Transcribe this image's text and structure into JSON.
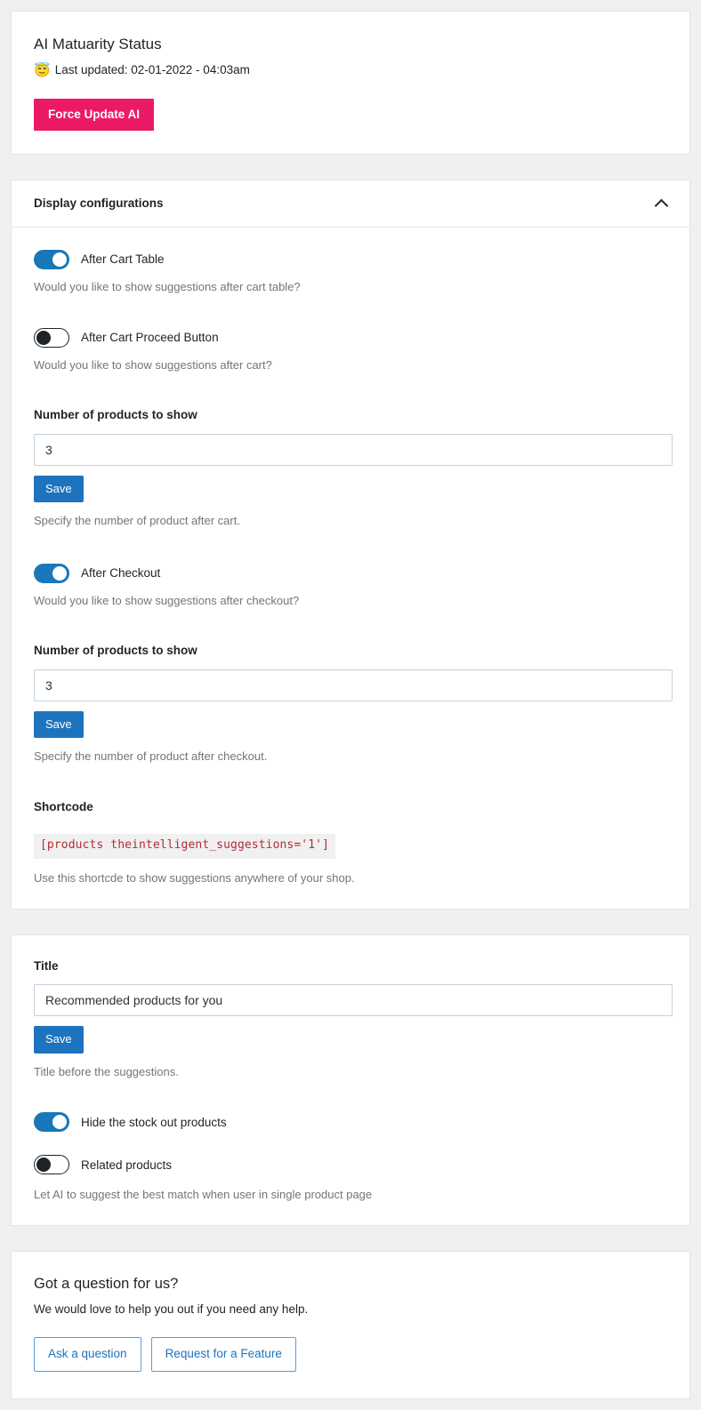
{
  "status_card": {
    "title": "AI Matuarity Status",
    "emoji": "😇",
    "last_updated": "Last updated: 02-01-2022 - 04:03am",
    "force_update_label": "Force Update AI"
  },
  "display_config": {
    "header_title": "Display configurations",
    "collapse_icon": "chevron-up-icon",
    "toggles": [
      {
        "label": "After Cart Table",
        "state": "on",
        "helper": "Would you like to show suggestions after cart table?"
      },
      {
        "label": "After Cart Proceed Button",
        "state": "off",
        "helper": "Would you like to show suggestions after cart?"
      }
    ],
    "after_cart_count": {
      "label": "Number of products to show",
      "value": "3",
      "save_label": "Save",
      "helper": "Specify the number of product after cart."
    },
    "after_checkout_toggle": {
      "label": "After Checkout",
      "state": "on",
      "helper": "Would you like to show suggestions after checkout?"
    },
    "after_checkout_count": {
      "label": "Number of products to show",
      "value": "3",
      "save_label": "Save",
      "helper": "Specify the number of product after checkout."
    },
    "shortcode": {
      "label": "Shortcode",
      "code": "[products theintelligent_suggestions='1']",
      "helper": "Use this shortcde to show suggestions anywhere of your shop."
    }
  },
  "title_card": {
    "label": "Title",
    "value": "Recommended products for you",
    "save_label": "Save",
    "helper": "Title before the suggestions.",
    "toggles": [
      {
        "label": "Hide the stock out products",
        "state": "on"
      },
      {
        "label": "Related products",
        "state": "off"
      }
    ],
    "related_helper": "Let AI to suggest the best match when user in single product page"
  },
  "question_card": {
    "title": "Got a question for us?",
    "subtitle": "We would love to help you out if you need any help.",
    "ask_label": "Ask a question",
    "feature_label": "Request for a Feature"
  },
  "colors": {
    "pink": "#ec1a66",
    "blue": "#1e73be",
    "toggle_on": "#1878b9",
    "code_red": "#b32d2e",
    "page_bg": "#f0f0f1"
  }
}
